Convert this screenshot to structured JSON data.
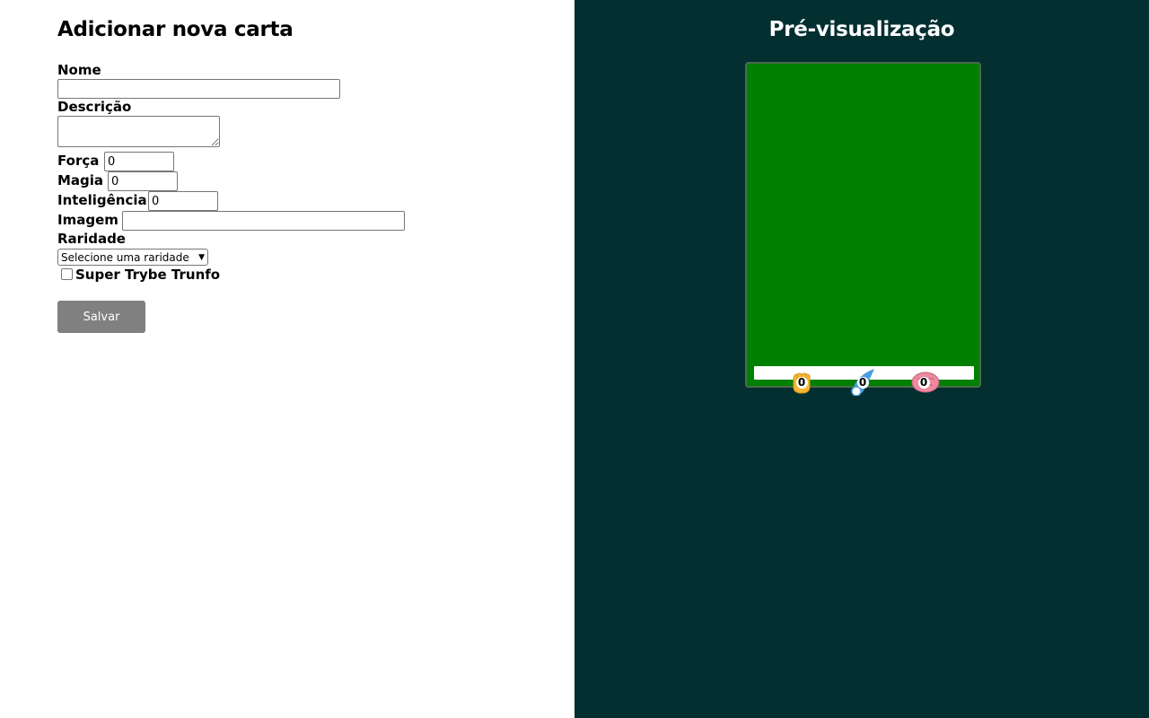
{
  "form": {
    "title": "Adicionar nova carta",
    "name_label": "Nome",
    "name_value": "",
    "description_label": "Descrição",
    "description_value": "",
    "strength_label": "Força",
    "strength_value": "0",
    "magic_label": "Magia",
    "magic_value": "0",
    "intelligence_label": "Inteligência",
    "intelligence_value": "0",
    "image_label": "Imagem",
    "image_value": "",
    "rarity_label": "Raridade",
    "rarity_selected": "Selecione uma raridade",
    "super_trunfo_label": "Super Trybe Trunfo",
    "super_trunfo_checked": false,
    "save_label": "Salvar"
  },
  "preview": {
    "title": "Pré-visualização",
    "card": {
      "strength": "0",
      "magic": "0",
      "intelligence": "0"
    }
  },
  "colors": {
    "preview_background": "#032f31",
    "card_background": "#008000",
    "save_button": "#808080",
    "strength_icon": "#f5b731",
    "magic_icon": "#4a9fe0",
    "intelligence_icon": "#ee8aa0"
  },
  "icons": {
    "strength": "fist-icon",
    "magic": "magic-comet-icon",
    "intelligence": "brain-icon"
  }
}
